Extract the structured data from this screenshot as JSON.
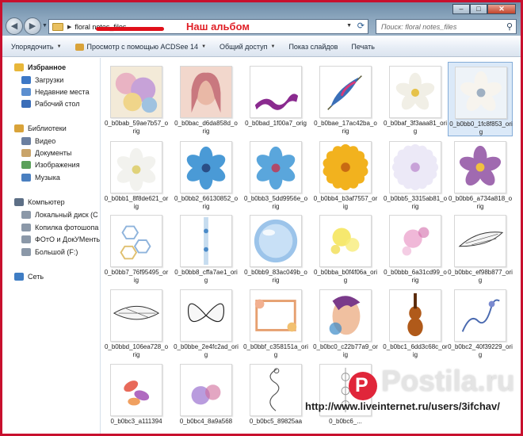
{
  "window": {
    "minimize": "–",
    "maximize": "□",
    "close": "✕"
  },
  "address_bar": {
    "path": "floral notes_files",
    "annotation": "Наш альбом"
  },
  "search": {
    "placeholder": "Поиск: floral notes_files"
  },
  "toolbar": {
    "organize": "Упорядочить",
    "preview": "Просмотр с помощью ACDSee 14",
    "share": "Общий доступ",
    "slideshow": "Показ слайдов",
    "print": "Печать"
  },
  "sidebar": {
    "items": [
      {
        "label": "Избранное",
        "icon": "star-icon",
        "kind": "fav"
      },
      {
        "label": "Загрузки",
        "icon": "downloads-icon",
        "kind": "item"
      },
      {
        "label": "Недавние места",
        "icon": "recent-places-icon",
        "kind": "item"
      },
      {
        "label": "Рабочий стол",
        "icon": "desktop-icon",
        "kind": "item"
      },
      {
        "label": "Библиотеки",
        "icon": "libraries-icon",
        "kind": "group"
      },
      {
        "label": "Видео",
        "icon": "video-icon",
        "kind": "item"
      },
      {
        "label": "Документы",
        "icon": "documents-icon",
        "kind": "item"
      },
      {
        "label": "Изображения",
        "icon": "images-icon",
        "kind": "item"
      },
      {
        "label": "Музыка",
        "icon": "music-icon",
        "kind": "item"
      },
      {
        "label": "Компьютер",
        "icon": "computer-icon",
        "kind": "group"
      },
      {
        "label": "Локальный диск (C",
        "icon": "drive-icon",
        "kind": "item"
      },
      {
        "label": "Копилка фотошопа",
        "icon": "drive-icon",
        "kind": "item"
      },
      {
        "label": "ФОтО и ДокУМенты",
        "icon": "drive-icon",
        "kind": "item"
      },
      {
        "label": "Большой (F:)",
        "icon": "drive-icon",
        "kind": "item"
      },
      {
        "label": "Сеть",
        "icon": "network-icon",
        "kind": "group"
      }
    ]
  },
  "files": [
    {
      "name": "0_b0bab_59ae7b57_orig",
      "thumb": "collage"
    },
    {
      "name": "0_b0bac_d6da858d_orig",
      "thumb": "woman"
    },
    {
      "name": "0_b0bad_1f00a7_orig",
      "thumb": "ribbon"
    },
    {
      "name": "0_b0bae_17ac42ba_orig",
      "thumb": "feather"
    },
    {
      "name": "0_b0baf_3f3aaa81_orig",
      "thumb": "white-flower-yellow"
    },
    {
      "name": "0_b0bb0_1fc8f853_orig",
      "thumb": "white-flower"
    },
    {
      "name": "0_b0bb1_8f8de621_orig",
      "thumb": "white-lily"
    },
    {
      "name": "0_b0bb2_66130852_orig",
      "thumb": "blue-flower"
    },
    {
      "name": "0_b0bb3_5dd9956e_orig",
      "thumb": "blue-flower-2"
    },
    {
      "name": "0_b0bb4_b3af7557_orig",
      "thumb": "yellow-daisy"
    },
    {
      "name": "0_b0bb5_3315ab81_orig",
      "thumb": "white-daisy"
    },
    {
      "name": "0_b0bb6_a734a818_orig",
      "thumb": "purple-flower"
    },
    {
      "name": "0_b0bb7_76f95495_orig",
      "thumb": "hexagons"
    },
    {
      "name": "0_b0bb8_cffa7ae1_orig",
      "thumb": "blue-strip"
    },
    {
      "name": "0_b0bb9_83ac049b_orig",
      "thumb": "glass-orb"
    },
    {
      "name": "0_b0bba_b0f4f06a_orig",
      "thumb": "yellow-splash"
    },
    {
      "name": "0_b0bbb_6a31cd99_orig",
      "thumb": "pink-splash"
    },
    {
      "name": "0_b0bbc_ef98b877_orig",
      "thumb": "wing"
    },
    {
      "name": "0_b0bbd_106ea728_orig",
      "thumb": "wing-2"
    },
    {
      "name": "0_b0bbe_2e4fc2ad_orig",
      "thumb": "butterfly"
    },
    {
      "name": "0_b0bbf_c358151a_orig",
      "thumb": "floral-frame"
    },
    {
      "name": "0_b0bc0_c22b77a9_orig",
      "thumb": "color-face"
    },
    {
      "name": "0_b0bc1_6dd3c68c_orig",
      "thumb": "violin"
    },
    {
      "name": "0_b0bc2_40f39229_orig",
      "thumb": "blue-scribble"
    },
    {
      "name": "0_b0bc3_a111394",
      "thumb": "leaves"
    },
    {
      "name": "0_b0bc4_8a9a568",
      "thumb": "purple-splash"
    },
    {
      "name": "0_b0bc5_89825aa",
      "thumb": "swirl"
    },
    {
      "name": "0_b0bc6_...",
      "thumb": "lace"
    }
  ],
  "watermark": {
    "logo_letter": "P",
    "brand": "Postila.ru",
    "url": "http://www.liveinternet.ru/users/3ifchav/"
  },
  "colors": {
    "border_red": "#c8102e",
    "selection": "#dbe9f8",
    "annotation_red": "#e01f26"
  }
}
